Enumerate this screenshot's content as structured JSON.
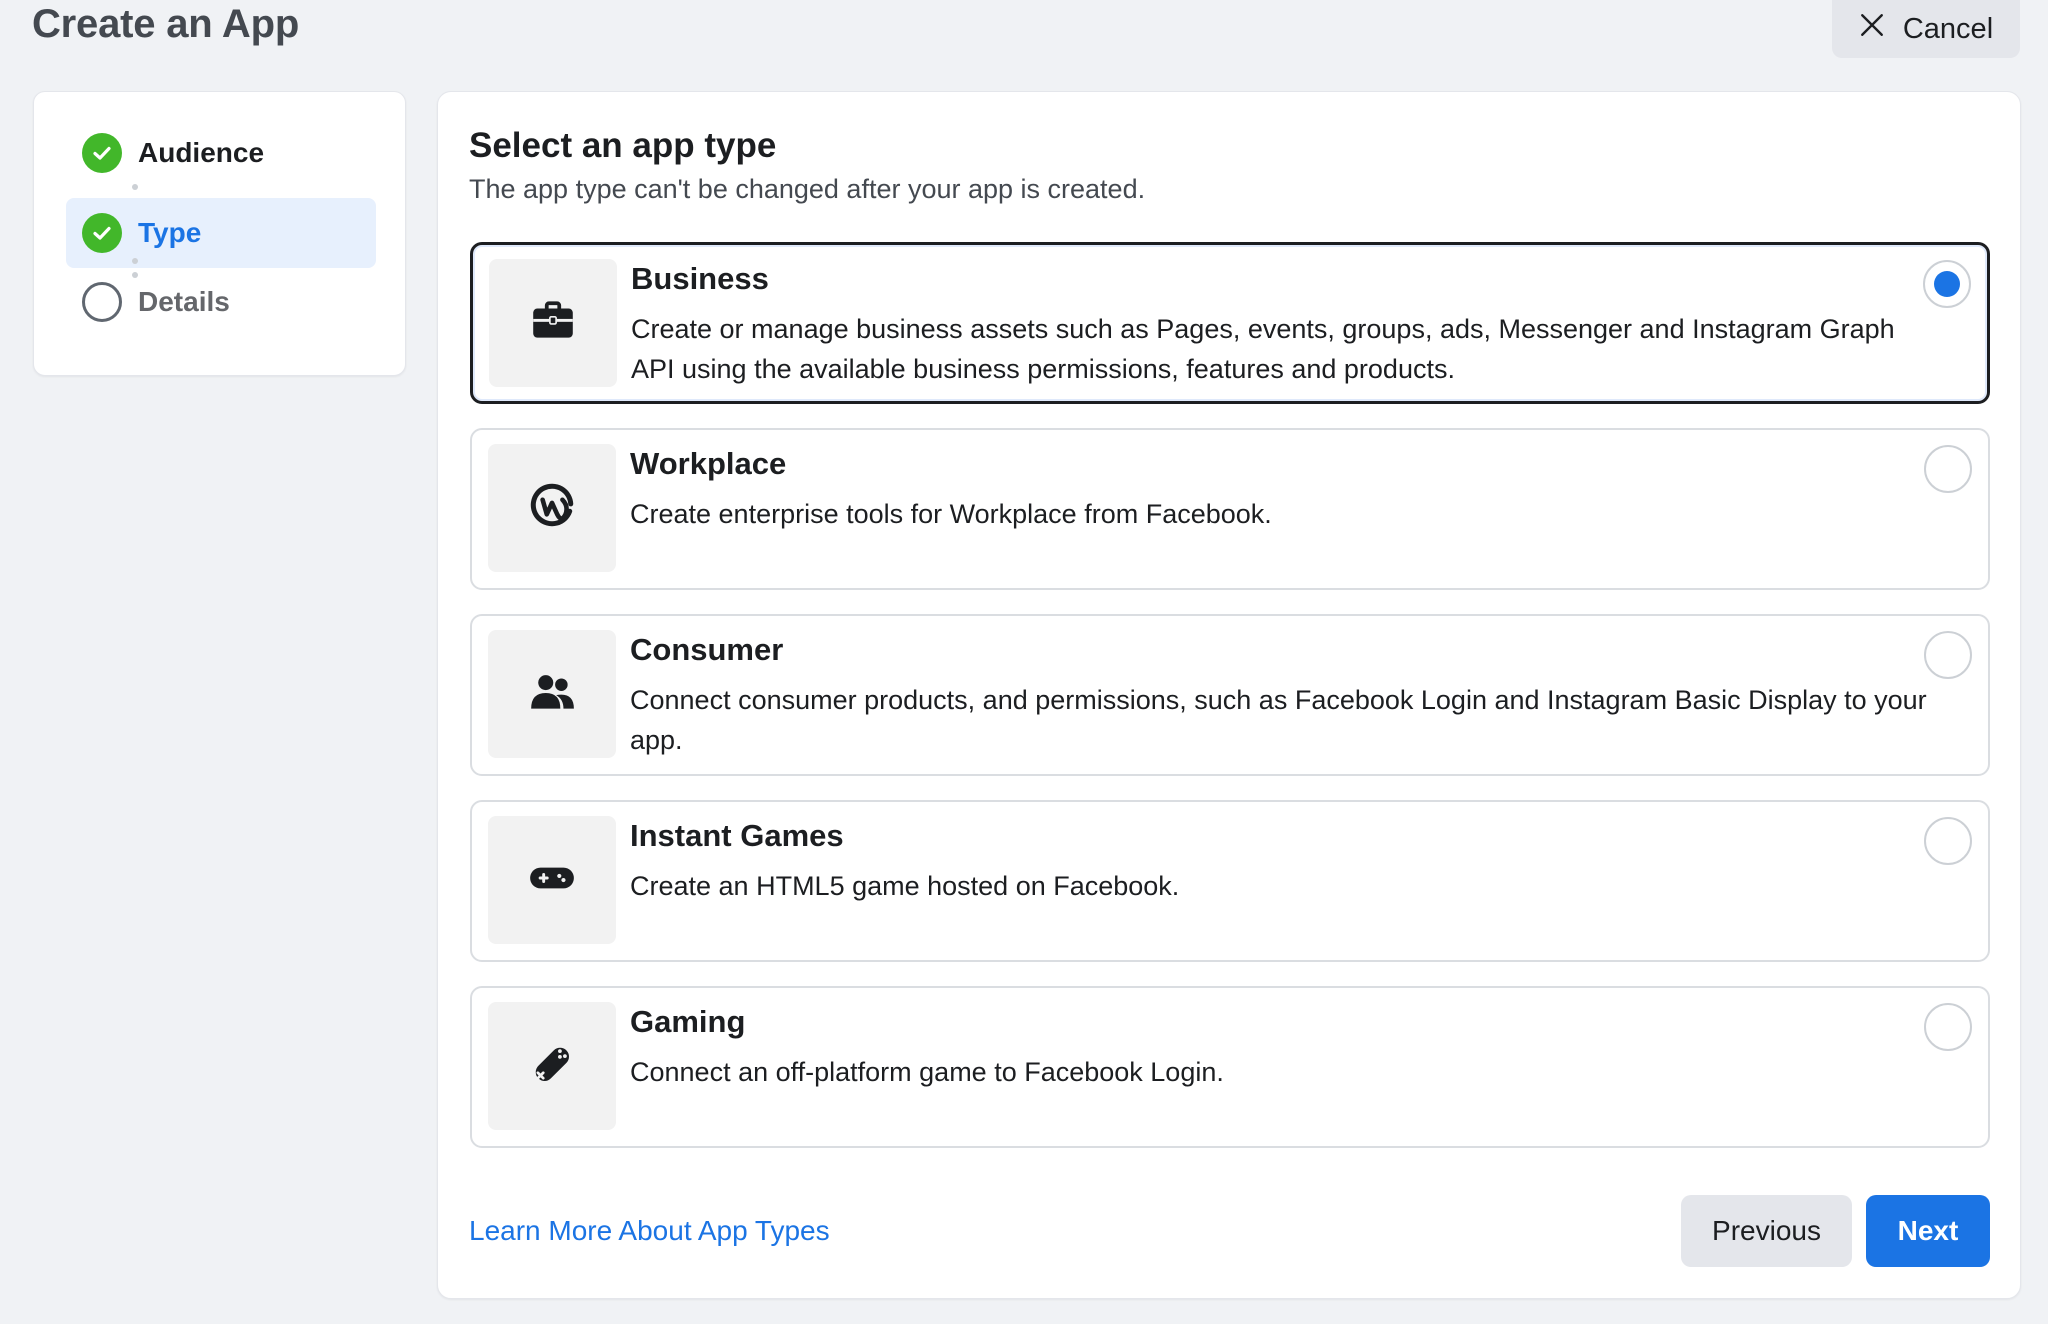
{
  "header": {
    "title": "Create an App",
    "cancel_label": "Cancel"
  },
  "stepper": {
    "steps": [
      {
        "label": "Audience",
        "state": "complete"
      },
      {
        "label": "Type",
        "state": "complete-active"
      },
      {
        "label": "Details",
        "state": "incomplete"
      }
    ]
  },
  "main": {
    "title": "Select an app type",
    "subtitle": "The app type can't be changed after your app is created.",
    "options": [
      {
        "title": "Business",
        "description": "Create or manage business assets such as Pages, events, groups, ads, Messenger and Instagram Graph API using the available business permissions, features and products.",
        "icon": "briefcase-icon",
        "selected": true
      },
      {
        "title": "Workplace",
        "description": "Create enterprise tools for Workplace from Facebook.",
        "icon": "workplace-logo-icon",
        "selected": false
      },
      {
        "title": "Consumer",
        "description": "Connect consumer products, and permissions, such as Facebook Login and Instagram Basic Display to your app.",
        "icon": "people-icon",
        "selected": false
      },
      {
        "title": "Instant Games",
        "description": "Create an HTML5 game hosted on Facebook.",
        "icon": "game-controller-icon",
        "selected": false
      },
      {
        "title": "Gaming",
        "description": "Connect an off-platform game to Facebook Login.",
        "icon": "gamepad-icon",
        "selected": false
      }
    ],
    "learn_more_label": "Learn More About App Types",
    "previous_label": "Previous",
    "next_label": "Next"
  },
  "colors": {
    "accent": "#1b74e4",
    "success": "#42b72a",
    "background": "#f0f2f5"
  }
}
